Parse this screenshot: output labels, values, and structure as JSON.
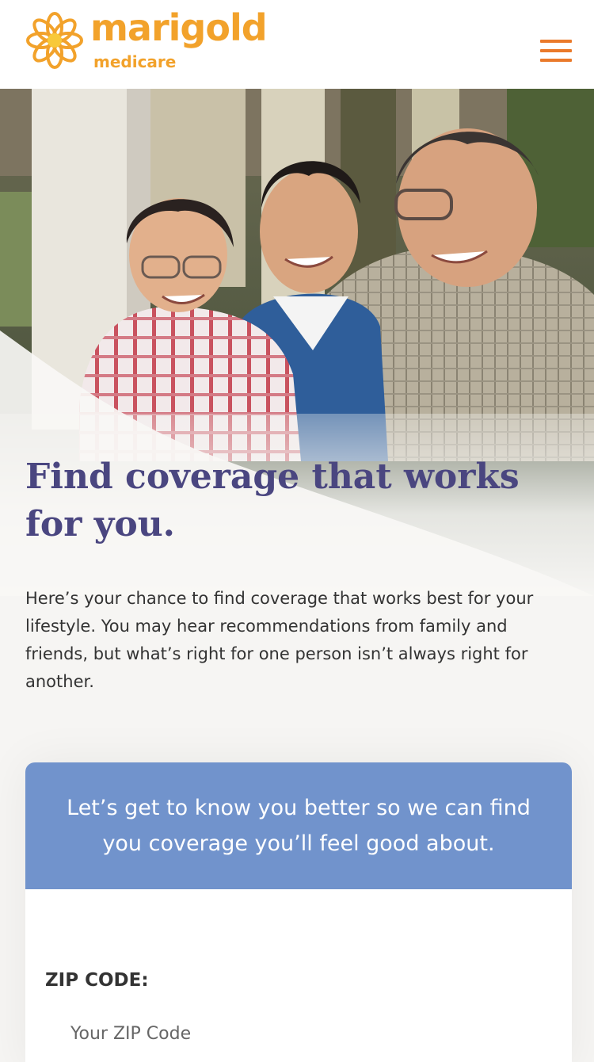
{
  "header": {
    "brand_name": "marigold",
    "brand_sub": "medicare",
    "brand_color": "#f2a22b",
    "menu_color": "#ea7a2b"
  },
  "hero": {
    "image": "family-photo"
  },
  "main": {
    "headline": "Find coverage that works for you.",
    "intro": "Here’s your chance to find coverage that works best for your lifestyle. You may hear recommendations from family and friends, but what’s right for one person isn’t always right for another."
  },
  "form": {
    "header_text": "Let’s get to know you better so we can find you coverage you’ll feel good about.",
    "header_color": "#7193cc",
    "zip_label": "ZIP CODE:",
    "zip_placeholder": "Your ZIP Code",
    "zip_value": ""
  },
  "colors": {
    "headline": "#4a4680",
    "body_text": "#333333"
  }
}
